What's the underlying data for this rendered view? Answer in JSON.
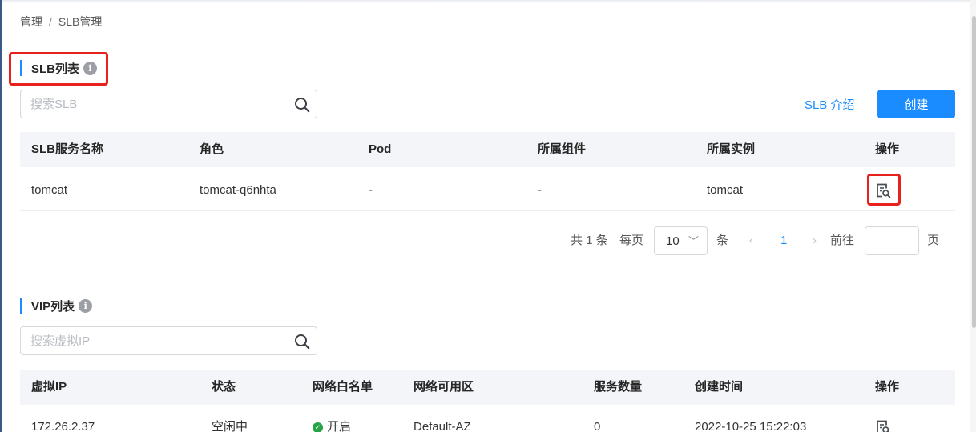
{
  "breadcrumb": {
    "root": "管理",
    "separator": "/",
    "current": "SLB管理"
  },
  "slb_section": {
    "title": "SLB列表",
    "search_placeholder": "搜索SLB",
    "intro_link": "SLB 介绍",
    "create_button": "创建",
    "columns": [
      "SLB服务名称",
      "角色",
      "Pod",
      "所属组件",
      "所属实例",
      "操作"
    ],
    "rows": [
      {
        "name": "tomcat",
        "role": "tomcat-q6nhta",
        "pod": "-",
        "component": "-",
        "instance": "tomcat",
        "action_icon": "detail-search-icon"
      }
    ],
    "pagination": {
      "total_text": "共 1 条",
      "per_page_label": "每页",
      "page_size": "10",
      "unit": "条",
      "prev": "‹",
      "current_page": "1",
      "next": "›",
      "goto_label": "前往",
      "page_suffix": "页"
    }
  },
  "vip_section": {
    "title": "VIP列表",
    "search_placeholder": "搜索虚拟IP",
    "columns": [
      "虚拟IP",
      "状态",
      "网络白名单",
      "网络可用区",
      "服务数量",
      "创建时间",
      "操作"
    ],
    "rows": [
      {
        "ip": "172.26.2.37",
        "status": "空闲中",
        "whitelist": "开启",
        "zone": "Default-AZ",
        "service_count": "0",
        "created": "2022-10-25 15:22:03",
        "action_icon": "detail-search-icon"
      }
    ]
  },
  "colors": {
    "accent": "#1a8cff",
    "highlight_box": "#e8211d",
    "success": "#27a348"
  }
}
